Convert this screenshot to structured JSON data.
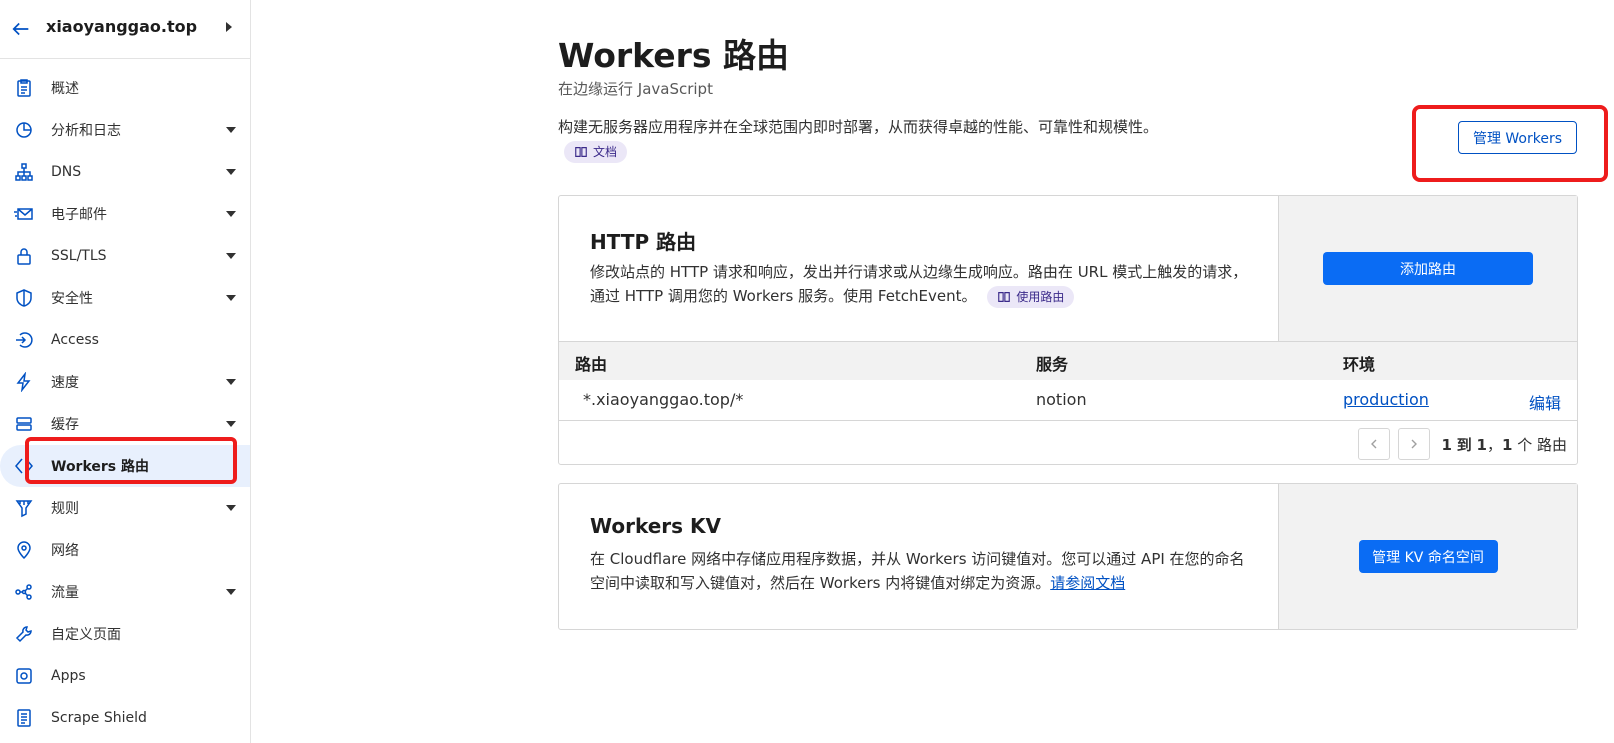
{
  "sidebar": {
    "site_name": "xiaoyanggao.top",
    "items": [
      {
        "label": "概述",
        "icon": "clipboard-icon",
        "caret": false
      },
      {
        "label": "分析和日志",
        "icon": "pie-chart-icon",
        "caret": true
      },
      {
        "label": "DNS",
        "icon": "sitemap-icon",
        "caret": true
      },
      {
        "label": "电子邮件",
        "icon": "envelope-icon",
        "caret": true
      },
      {
        "label": "SSL/TLS",
        "icon": "lock-icon",
        "caret": true
      },
      {
        "label": "安全性",
        "icon": "shield-icon",
        "caret": true
      },
      {
        "label": "Access",
        "icon": "access-icon",
        "caret": false
      },
      {
        "label": "速度",
        "icon": "lightning-icon",
        "caret": true
      },
      {
        "label": "缓存",
        "icon": "stack-icon",
        "caret": true
      },
      {
        "label": "Workers 路由",
        "icon": "workers-icon",
        "caret": false,
        "active": true
      },
      {
        "label": "规则",
        "icon": "funnel-icon",
        "caret": true
      },
      {
        "label": "网络",
        "icon": "location-pin-icon",
        "caret": false
      },
      {
        "label": "流量",
        "icon": "share-nodes-icon",
        "caret": true
      },
      {
        "label": "自定义页面",
        "icon": "wrench-icon",
        "caret": false
      },
      {
        "label": "Apps",
        "icon": "apps-icon",
        "caret": false
      },
      {
        "label": "Scrape Shield",
        "icon": "document-icon",
        "caret": false
      }
    ]
  },
  "header": {
    "title": "Workers 路由",
    "subtitle": "在边缘运行 JavaScript",
    "description": "构建无服务器应用程序并在全球范围内即时部署，从而获得卓越的性能、可靠性和规模性。",
    "doc_label": "文档",
    "manage_button": "管理 Workers"
  },
  "http_routes": {
    "title": "HTTP 路由",
    "description": "修改站点的 HTTP 请求和响应，发出并行请求或从边缘生成响应。路由在 URL 模式上触发的请求，通过 HTTP 调用您的 Workers 服务。使用 FetchEvent。",
    "doc_label": "使用路由",
    "add_button": "添加路由",
    "columns": [
      "路由",
      "服务",
      "环境"
    ],
    "rows": [
      {
        "route": "*.xiaoyanggao.top/*",
        "service": "notion",
        "environment": "production",
        "action": "编辑"
      }
    ],
    "pager": {
      "from": "1",
      "to_word": "到",
      "to": "1",
      "of_sep": "，",
      "total": "1",
      "suffix": "个 路由"
    }
  },
  "kv": {
    "title": "Workers KV",
    "description": "在 Cloudflare 网络中存储应用程序数据，并从 Workers 访问键值对。您可以通过 API 在您的命名空间中读取和写入键值对，然后在 Workers 内将键值对绑定为资源。",
    "link": "请参阅文档",
    "button": "管理 KV 命名空间"
  },
  "colors": {
    "accent": "#0051c3",
    "primary_button": "#0a6cf4",
    "highlight": "#ee1c1c",
    "active_bg": "#e8f0fd"
  }
}
